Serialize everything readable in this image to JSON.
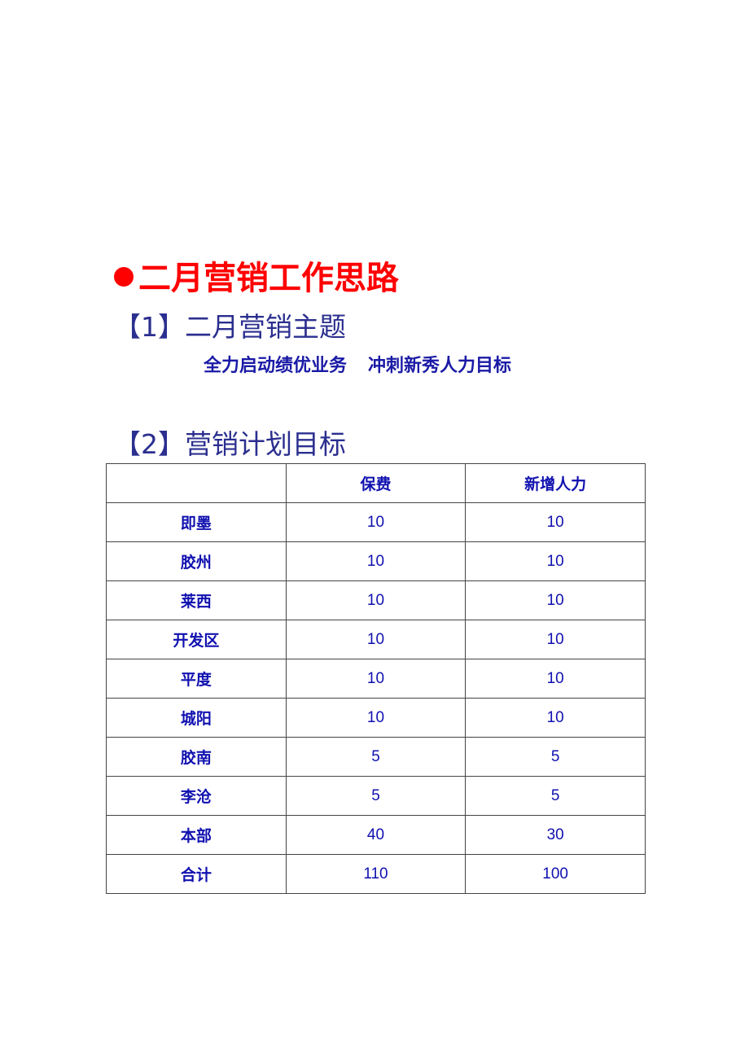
{
  "title": "二月营销工作思路",
  "section1": {
    "heading": "【1】二月营销主题",
    "theme_part1": "全力启动绩优业务",
    "theme_part2": "冲刺新秀人力目标"
  },
  "section2": {
    "heading": "【2】营销计划目标"
  },
  "table": {
    "headers": [
      "",
      "保费",
      "新增人力"
    ],
    "rows": [
      [
        "即墨",
        "10",
        "10"
      ],
      [
        "胶州",
        "10",
        "10"
      ],
      [
        "莱西",
        "10",
        "10"
      ],
      [
        "开发区",
        "10",
        "10"
      ],
      [
        "平度",
        "10",
        "10"
      ],
      [
        "城阳",
        "10",
        "10"
      ],
      [
        "胶南",
        "5",
        "5"
      ],
      [
        "李沧",
        "5",
        "5"
      ],
      [
        "本部",
        "40",
        "30"
      ],
      [
        "合计",
        "110",
        "100"
      ]
    ]
  },
  "colors": {
    "title": "#ff0000",
    "heading": "#2b2f8f",
    "table_text": "#1010b0"
  }
}
